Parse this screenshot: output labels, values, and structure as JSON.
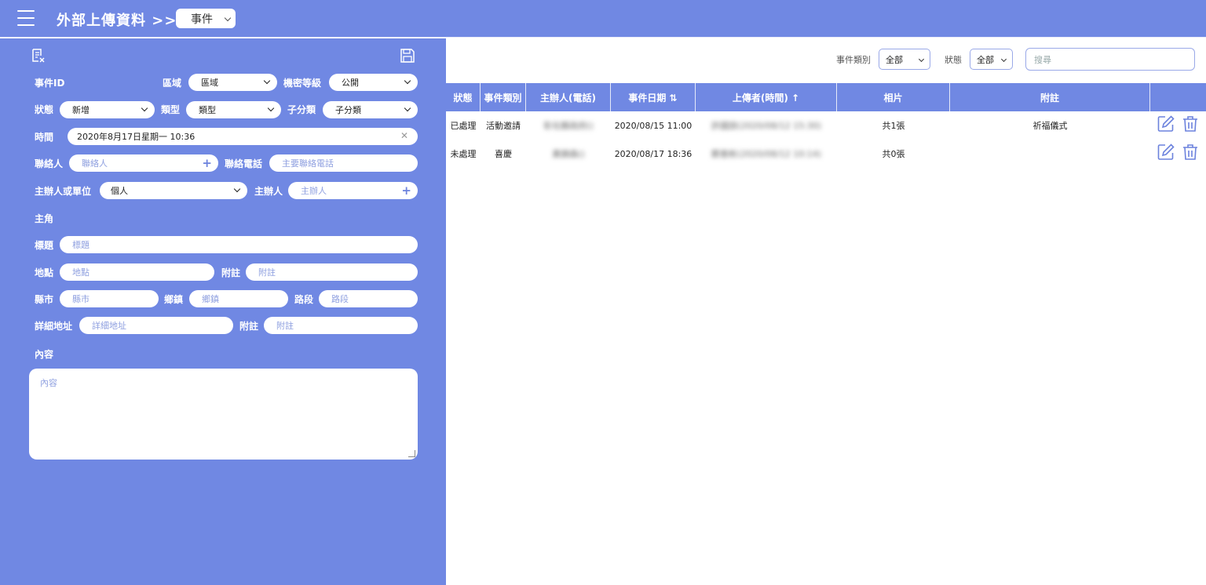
{
  "header": {
    "title": "外部上傳資料 >>",
    "module": "事件"
  },
  "form": {
    "event_id_label": "事件ID",
    "region_label": "區域",
    "region_value": "區域",
    "secrecy_label": "機密等級",
    "secrecy_value": "公開",
    "status_label": "狀態",
    "status_value": "新增",
    "type_label": "類型",
    "type_value": "類型",
    "subcat_label": "子分類",
    "subcat_value": "子分類",
    "time_label": "時間",
    "time_value": "2020年8月17日星期一 10:36",
    "contact_label": "聯絡人",
    "contact_ph": "聯絡人",
    "phone_label": "聯絡電話",
    "phone_ph": "主要聯絡電話",
    "host_type_label": "主辦人或單位",
    "host_type_value": "個人",
    "host_label": "主辦人",
    "host_ph": "主辦人",
    "protagonist_label": "主角",
    "title_label": "標題",
    "title_ph": "標題",
    "place_label": "地點",
    "place_ph": "地點",
    "note1_label": "附註",
    "note1_ph": "附註",
    "city_label": "縣市",
    "city_ph": "縣市",
    "town_label": "鄉鎮",
    "town_ph": "鄉鎮",
    "road_label": "路段",
    "road_ph": "路段",
    "address_label": "詳細地址",
    "address_ph": "詳細地址",
    "note2_label": "附註",
    "note2_ph": "附註",
    "content_label": "內容",
    "content_ph": "內容"
  },
  "filters": {
    "category_label": "事件類別",
    "category_value": "全部",
    "status_label": "狀態",
    "status_value": "全部",
    "search_ph": "搜尋"
  },
  "table": {
    "headers": [
      "狀態",
      "事件類別",
      "主辦人(電話)",
      "事件日期 ⇅",
      "上傳者(時間) ↑",
      "相片",
      "附註"
    ],
    "rows": [
      {
        "status": "已處理",
        "category": "活動邀請",
        "host": "彰化縣政府()",
        "date": "2020/08/15 11:00",
        "uploader": "許國諒(2020/08/12 15:30)",
        "photos": "共1張",
        "note": "祈福儀式"
      },
      {
        "status": "未處理",
        "category": "喜慶",
        "host": "黃錦森()",
        "date": "2020/08/17 18:36",
        "uploader": "鄭善彬(2020/08/12 10:14)",
        "photos": "共0張",
        "note": ""
      }
    ]
  },
  "colors": {
    "primary": "#7088e3",
    "icon": "#6c82dd"
  }
}
